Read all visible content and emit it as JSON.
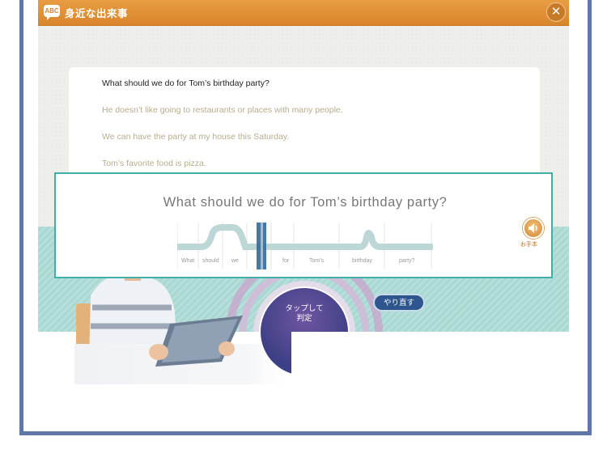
{
  "window": {
    "icon_text": "ABC",
    "title": "身近な出来事",
    "close_label": "✕"
  },
  "passage": {
    "question": "What should we do for Tom’s birthday party?",
    "lines": [
      "He doesn’t like going to restaurants or places with many people.",
      "We can have the party at my house this Saturday.",
      "Tom’s favorite food is pizza."
    ]
  },
  "practice": {
    "target_sentence": "What should we do for Tom’s birthday party?",
    "words": [
      "What",
      "should",
      "we",
      "for",
      "Tom’s",
      "birthday",
      "party?"
    ],
    "model_label": "お手本"
  },
  "controls": {
    "judge_line1": "タップして",
    "judge_line2": "判定",
    "retry_label": "やり直す"
  },
  "colors": {
    "titlebar": "#e08f36",
    "accent_teal": "#3fb0a8",
    "judge_button": "#4a3f8f",
    "frame": "#5f78a8"
  }
}
